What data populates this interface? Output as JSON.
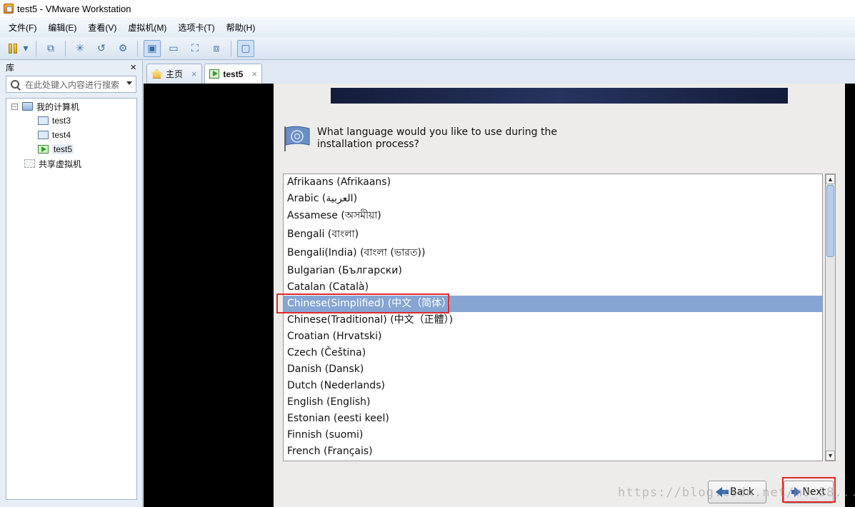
{
  "window": {
    "title": "test5 - VMware Workstation"
  },
  "menu": [
    "文件(F)",
    "编辑(E)",
    "查看(V)",
    "虚拟机(M)",
    "选项卡(T)",
    "帮助(H)"
  ],
  "library": {
    "title": "库",
    "close": "×",
    "search_placeholder": "在此处键入内容进行搜索",
    "tree": {
      "my_computer": "我的计算机",
      "vms": [
        "test3",
        "test4",
        "test5"
      ],
      "shared": "共享虚拟机"
    }
  },
  "tabs": [
    {
      "label": "主页",
      "close": "×"
    },
    {
      "label": "test5",
      "close": "×"
    }
  ],
  "installer": {
    "question": "What language would you like to use during the installation process?",
    "languages": [
      "Afrikaans (Afrikaans)",
      "Arabic (العربية)",
      "Assamese (অসমীয়া)",
      "Bengali (বাংলা)",
      "Bengali(India) (বাংলা (ভারত))",
      "Bulgarian (Български)",
      "Catalan (Català)",
      "Chinese(Simplified) (中文（简体）)",
      "Chinese(Traditional) (中文（正體）)",
      "Croatian (Hrvatski)",
      "Czech (Čeština)",
      "Danish (Dansk)",
      "Dutch (Nederlands)",
      "English (English)",
      "Estonian (eesti keel)",
      "Finnish (suomi)",
      "French (Français)"
    ],
    "selected_language": "Chinese(Simplified) (中文（简体）)",
    "back_label": "Back",
    "next_label": "Next"
  },
  "watermark": "https://blog.csdn.net/m0_38..."
}
